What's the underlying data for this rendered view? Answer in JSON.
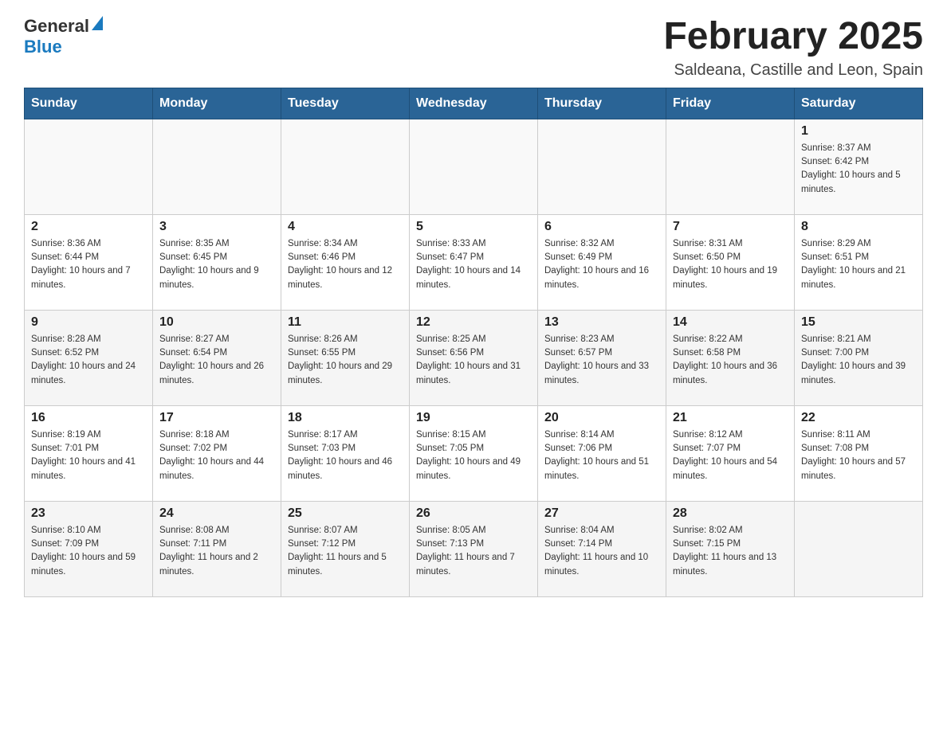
{
  "header": {
    "logo": {
      "text_general": "General",
      "triangle": "▲",
      "text_blue": "Blue"
    },
    "title": "February 2025",
    "subtitle": "Saldeana, Castille and Leon, Spain"
  },
  "calendar": {
    "days_of_week": [
      "Sunday",
      "Monday",
      "Tuesday",
      "Wednesday",
      "Thursday",
      "Friday",
      "Saturday"
    ],
    "weeks": [
      [
        {
          "day": "",
          "sunrise": "",
          "sunset": "",
          "daylight": ""
        },
        {
          "day": "",
          "sunrise": "",
          "sunset": "",
          "daylight": ""
        },
        {
          "day": "",
          "sunrise": "",
          "sunset": "",
          "daylight": ""
        },
        {
          "day": "",
          "sunrise": "",
          "sunset": "",
          "daylight": ""
        },
        {
          "day": "",
          "sunrise": "",
          "sunset": "",
          "daylight": ""
        },
        {
          "day": "",
          "sunrise": "",
          "sunset": "",
          "daylight": ""
        },
        {
          "day": "1",
          "sunrise": "Sunrise: 8:37 AM",
          "sunset": "Sunset: 6:42 PM",
          "daylight": "Daylight: 10 hours and 5 minutes."
        }
      ],
      [
        {
          "day": "2",
          "sunrise": "Sunrise: 8:36 AM",
          "sunset": "Sunset: 6:44 PM",
          "daylight": "Daylight: 10 hours and 7 minutes."
        },
        {
          "day": "3",
          "sunrise": "Sunrise: 8:35 AM",
          "sunset": "Sunset: 6:45 PM",
          "daylight": "Daylight: 10 hours and 9 minutes."
        },
        {
          "day": "4",
          "sunrise": "Sunrise: 8:34 AM",
          "sunset": "Sunset: 6:46 PM",
          "daylight": "Daylight: 10 hours and 12 minutes."
        },
        {
          "day": "5",
          "sunrise": "Sunrise: 8:33 AM",
          "sunset": "Sunset: 6:47 PM",
          "daylight": "Daylight: 10 hours and 14 minutes."
        },
        {
          "day": "6",
          "sunrise": "Sunrise: 8:32 AM",
          "sunset": "Sunset: 6:49 PM",
          "daylight": "Daylight: 10 hours and 16 minutes."
        },
        {
          "day": "7",
          "sunrise": "Sunrise: 8:31 AM",
          "sunset": "Sunset: 6:50 PM",
          "daylight": "Daylight: 10 hours and 19 minutes."
        },
        {
          "day": "8",
          "sunrise": "Sunrise: 8:29 AM",
          "sunset": "Sunset: 6:51 PM",
          "daylight": "Daylight: 10 hours and 21 minutes."
        }
      ],
      [
        {
          "day": "9",
          "sunrise": "Sunrise: 8:28 AM",
          "sunset": "Sunset: 6:52 PM",
          "daylight": "Daylight: 10 hours and 24 minutes."
        },
        {
          "day": "10",
          "sunrise": "Sunrise: 8:27 AM",
          "sunset": "Sunset: 6:54 PM",
          "daylight": "Daylight: 10 hours and 26 minutes."
        },
        {
          "day": "11",
          "sunrise": "Sunrise: 8:26 AM",
          "sunset": "Sunset: 6:55 PM",
          "daylight": "Daylight: 10 hours and 29 minutes."
        },
        {
          "day": "12",
          "sunrise": "Sunrise: 8:25 AM",
          "sunset": "Sunset: 6:56 PM",
          "daylight": "Daylight: 10 hours and 31 minutes."
        },
        {
          "day": "13",
          "sunrise": "Sunrise: 8:23 AM",
          "sunset": "Sunset: 6:57 PM",
          "daylight": "Daylight: 10 hours and 33 minutes."
        },
        {
          "day": "14",
          "sunrise": "Sunrise: 8:22 AM",
          "sunset": "Sunset: 6:58 PM",
          "daylight": "Daylight: 10 hours and 36 minutes."
        },
        {
          "day": "15",
          "sunrise": "Sunrise: 8:21 AM",
          "sunset": "Sunset: 7:00 PM",
          "daylight": "Daylight: 10 hours and 39 minutes."
        }
      ],
      [
        {
          "day": "16",
          "sunrise": "Sunrise: 8:19 AM",
          "sunset": "Sunset: 7:01 PM",
          "daylight": "Daylight: 10 hours and 41 minutes."
        },
        {
          "day": "17",
          "sunrise": "Sunrise: 8:18 AM",
          "sunset": "Sunset: 7:02 PM",
          "daylight": "Daylight: 10 hours and 44 minutes."
        },
        {
          "day": "18",
          "sunrise": "Sunrise: 8:17 AM",
          "sunset": "Sunset: 7:03 PM",
          "daylight": "Daylight: 10 hours and 46 minutes."
        },
        {
          "day": "19",
          "sunrise": "Sunrise: 8:15 AM",
          "sunset": "Sunset: 7:05 PM",
          "daylight": "Daylight: 10 hours and 49 minutes."
        },
        {
          "day": "20",
          "sunrise": "Sunrise: 8:14 AM",
          "sunset": "Sunset: 7:06 PM",
          "daylight": "Daylight: 10 hours and 51 minutes."
        },
        {
          "day": "21",
          "sunrise": "Sunrise: 8:12 AM",
          "sunset": "Sunset: 7:07 PM",
          "daylight": "Daylight: 10 hours and 54 minutes."
        },
        {
          "day": "22",
          "sunrise": "Sunrise: 8:11 AM",
          "sunset": "Sunset: 7:08 PM",
          "daylight": "Daylight: 10 hours and 57 minutes."
        }
      ],
      [
        {
          "day": "23",
          "sunrise": "Sunrise: 8:10 AM",
          "sunset": "Sunset: 7:09 PM",
          "daylight": "Daylight: 10 hours and 59 minutes."
        },
        {
          "day": "24",
          "sunrise": "Sunrise: 8:08 AM",
          "sunset": "Sunset: 7:11 PM",
          "daylight": "Daylight: 11 hours and 2 minutes."
        },
        {
          "day": "25",
          "sunrise": "Sunrise: 8:07 AM",
          "sunset": "Sunset: 7:12 PM",
          "daylight": "Daylight: 11 hours and 5 minutes."
        },
        {
          "day": "26",
          "sunrise": "Sunrise: 8:05 AM",
          "sunset": "Sunset: 7:13 PM",
          "daylight": "Daylight: 11 hours and 7 minutes."
        },
        {
          "day": "27",
          "sunrise": "Sunrise: 8:04 AM",
          "sunset": "Sunset: 7:14 PM",
          "daylight": "Daylight: 11 hours and 10 minutes."
        },
        {
          "day": "28",
          "sunrise": "Sunrise: 8:02 AM",
          "sunset": "Sunset: 7:15 PM",
          "daylight": "Daylight: 11 hours and 13 minutes."
        },
        {
          "day": "",
          "sunrise": "",
          "sunset": "",
          "daylight": ""
        }
      ]
    ]
  }
}
